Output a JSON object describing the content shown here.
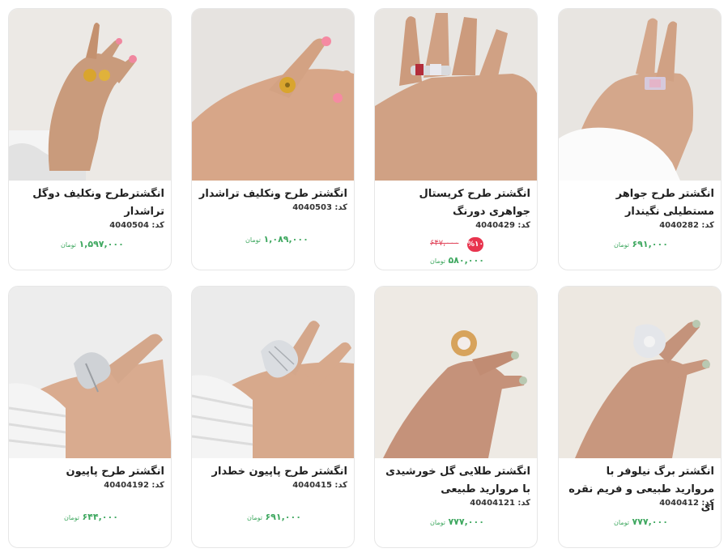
{
  "currency": "تومان",
  "code_label": "کد:",
  "products": [
    {
      "title": "انگشترطرح ونکلیف دوگل تراشدار",
      "code": "4040504",
      "price": "۱,۵۹۷,۰۰۰"
    },
    {
      "title": "انگشتر طرح ونکلیف تراشدار",
      "code": "4040503",
      "price": "۱,۰۸۹,۰۰۰"
    },
    {
      "title": "انگشتر طرح کریستال جواهری دورنگ",
      "code": "4040429",
      "price": "۵۸۰,۰۰۰",
      "old_price": "۶۴۷,۰۰۰",
      "discount": "%۱۰"
    },
    {
      "title": "انگشتر طرح جواهر مستطیلی نگیندار",
      "code": "4040282",
      "price": "۶۹۱,۰۰۰"
    },
    {
      "title": "انگشتر طرح پاپیون",
      "code": "40404192",
      "price": "۶۴۴,۰۰۰"
    },
    {
      "title": "انگشتر طرح پاپیون خطدار",
      "code": "4040415",
      "price": "۶۹۱,۰۰۰"
    },
    {
      "title": "انگشتر طلایی گل خورشیدی با مروارید طبیعی",
      "code": "40404121",
      "price": "۷۷۷,۰۰۰"
    },
    {
      "title": "انگشتر برگ نیلوفر با مروارید طبیعی و فریم نقره ای",
      "code": "4040412",
      "price": "۷۷۷,۰۰۰"
    }
  ],
  "colors": {
    "price": "#3fa860",
    "discount": "#e8344e",
    "ring_gold": "#d9a52e",
    "ring_silver": "#cfd2d6"
  }
}
